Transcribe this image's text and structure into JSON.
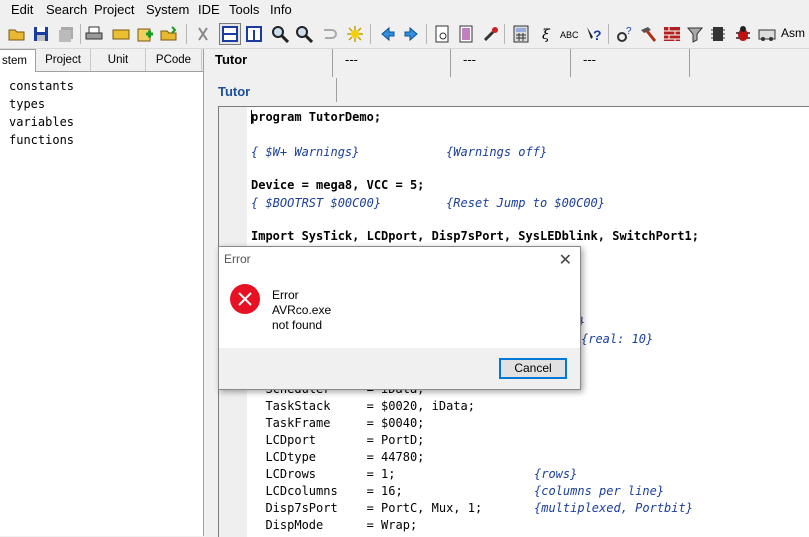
{
  "menu": [
    "Edit",
    "Search",
    "Project",
    "System",
    "IDE",
    "Tools",
    "Info"
  ],
  "toolbar": {
    "asm_label": "Asm"
  },
  "left_panel": {
    "tabs": [
      "stem",
      "Project",
      "Unit",
      "PCode"
    ],
    "tree": [
      "constants",
      "types",
      "variables",
      "functions"
    ]
  },
  "editor_tabs": [
    "Tutor",
    "---",
    "---",
    "---"
  ],
  "editor": {
    "file_tab": "Tutor",
    "lines": [
      {
        "text": "program TutorDemo;"
      },
      {
        "text": "{ $W+ Warnings}            {Warnings off}"
      },
      {
        "text": "Device = mega8, VCC = 5;"
      },
      {
        "text": "{ $BOOTRST $00C00}         {Reset Jump to $00C00}"
      },
      {
        "text": "Import SysTick, LCDport, Disp7sPort, SysLEDblink, SwitchPort1;"
      },
      {
        "text": "}"
      },
      {
        "text": "{real: 10}"
      },
      {
        "text": "  Scheduler     = iData;"
      },
      {
        "text": "  TaskStack     = $0020, iData;"
      },
      {
        "text": "  TaskFrame     = $0040;"
      },
      {
        "text": "  LCDport       = PortD;"
      },
      {
        "text": "  LCDtype       = 44780;"
      },
      {
        "text": "  LCDrows       = 1;"
      },
      {
        "text": "{rows}"
      },
      {
        "text": "  LCDcolumns    = 16;"
      },
      {
        "text": "{columns per line}"
      },
      {
        "text": "  Disp7sPort    = PortC, Mux, 1;"
      },
      {
        "text": "{multiplexed, Portbit}"
      },
      {
        "text": "  DispMode      = Wrap;"
      }
    ]
  },
  "dialog": {
    "title": "Error",
    "line1": "Error",
    "line2": "AVRco.exe",
    "line3": "not found",
    "cancel": "Cancel"
  },
  "colors": {
    "error_red": "#e81123",
    "accent": "#0078d7",
    "comment_blue": "#1b3f9c"
  }
}
